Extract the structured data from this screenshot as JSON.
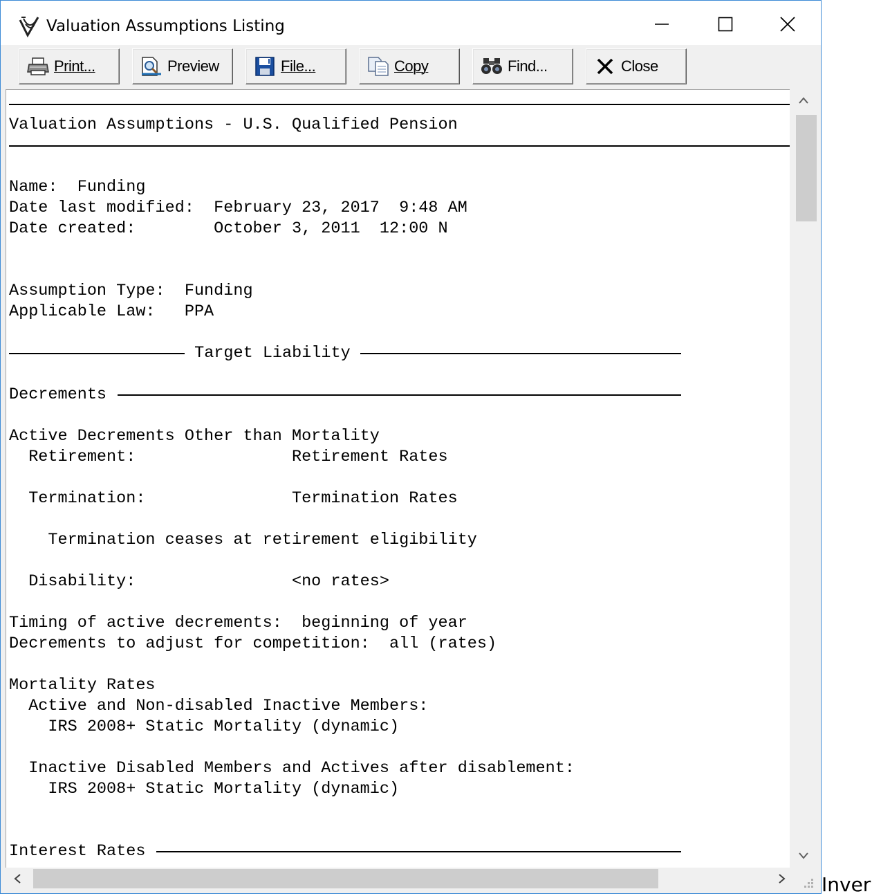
{
  "window": {
    "title": "Valuation Assumptions Listing",
    "icons": [
      "app-logo-icon",
      "minimize-icon",
      "maximize-icon",
      "close-icon"
    ]
  },
  "toolbar": {
    "buttons": [
      {
        "label": "Print...",
        "icon": "printer-icon"
      },
      {
        "label": "Preview",
        "icon": "preview-icon"
      },
      {
        "label": "File...",
        "icon": "floppy-disk-icon"
      },
      {
        "label": "Copy",
        "icon": "copy-icon"
      },
      {
        "label": "Find...",
        "icon": "binoculars-icon"
      },
      {
        "label": "Close",
        "icon": "close-x-icon"
      }
    ]
  },
  "listing": {
    "heading": "Valuation Assumptions - U.S. Qualified Pension",
    "name_line": "Name:  Funding",
    "modified_line": "Date last modified:  February 23, 2017  9:48 AM",
    "created_line": "Date created:        October 3, 2011  12:00 N",
    "assumption_type_line": "Assumption Type:  Funding",
    "applicable_law_line": "Applicable Law:   PPA",
    "section_target": " Target Liability ",
    "section_decrements": "Decrements ",
    "active_decrements": "Active Decrements Other than Mortality",
    "retirement_line": "  Retirement:                Retirement Rates",
    "termination_line": "  Termination:               Termination Rates",
    "termination_ceases": "    Termination ceases at retirement eligibility",
    "disability_line": "  Disability:                <no rates>",
    "timing_line": "Timing of active decrements:  beginning of year",
    "competition_line": "Decrements to adjust for competition:  all (rates)",
    "mortality_heading": "Mortality Rates",
    "active_nondisabled": "  Active and Non-disabled Inactive Members:",
    "mortality_table_1": "    IRS 2008+ Static Mortality (dynamic)",
    "inactive_disabled": "  Inactive Disabled Members and Actives after disablement:",
    "mortality_table_2": "    IRS 2008+ Static Mortality (dynamic)",
    "section_interest": "Interest Rates "
  },
  "stray_text": "Inver"
}
